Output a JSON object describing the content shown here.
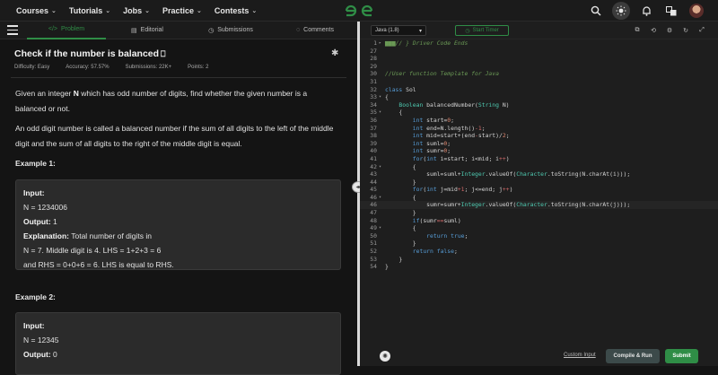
{
  "nav": {
    "items": [
      "Courses",
      "Tutorials",
      "Jobs",
      "Practice",
      "Contests"
    ],
    "icons": [
      "search-icon",
      "theme-toggle-icon",
      "bell-icon",
      "translate-icon"
    ]
  },
  "tabs": [
    {
      "icon": "</>",
      "label": "Problem"
    },
    {
      "icon": "▤",
      "label": "Editorial"
    },
    {
      "icon": "◷",
      "label": "Submissions"
    },
    {
      "icon": "◌",
      "label": "Comments"
    }
  ],
  "problem": {
    "title": "Check if the number is balanced",
    "difficulty": "Difficulty: Easy",
    "accuracy": "Accuracy: 57.57%",
    "submissions": "Submissions: 22K+",
    "points": "Points: 2",
    "para1_pre": "Given an integer ",
    "para1_bold": "N",
    "para1_post": " which has odd number of digits, find whether the given number is a balanced or not.",
    "para2": "An odd digit number is called a balanced number if the sum of all digits to the left of the middle digit and the sum of all digits to the right of the middle digit is equal.",
    "example1": {
      "heading": "Example 1:",
      "input_label": "Input:",
      "input_value": "N = 1234006",
      "output_label": "Output:",
      "output_value": " 1",
      "explanation_label": "Explanation:",
      "explanation_lines": [
        " Total  number  of  digits  in",
        "N = 7. Middle digit is 4. LHS = 1+2+3 = 6",
        "and  RHS = 0+0+6 = 6. LHS is equal to RHS."
      ]
    },
    "example2": {
      "heading": "Example 2:",
      "input_label": "Input:",
      "input_value": "N = 12345",
      "output_label": "Output:",
      "output_value": " 0"
    }
  },
  "editor": {
    "language": "Java (1.8)",
    "timer_label": "Start Timer",
    "tool_icons": [
      "copy-icon",
      "reset-icon",
      "settings-icon",
      "refresh-icon",
      "fullscreen-icon"
    ],
    "lines": [
      {
        "n": "1",
        "f": "▸",
        "html": "<span class=\"cmt\">▆▆▆// } Driver Code Ends</span>"
      },
      {
        "n": "27",
        "f": "",
        "html": ""
      },
      {
        "n": "28",
        "f": "",
        "html": ""
      },
      {
        "n": "29",
        "f": "",
        "html": ""
      },
      {
        "n": "30",
        "f": "",
        "html": "<span class=\"cmt\">//User function Template for Java</span>"
      },
      {
        "n": "31",
        "f": "",
        "html": ""
      },
      {
        "n": "32",
        "f": "",
        "html": "<span class=\"kw\">class</span> Sol"
      },
      {
        "n": "33",
        "f": "▾",
        "html": "{"
      },
      {
        "n": "34",
        "f": "",
        "html": "    <span class=\"ty\">Boolean</span> balancedNumber(<span class=\"ty\">String</span> N)"
      },
      {
        "n": "35",
        "f": "▾",
        "html": "    {"
      },
      {
        "n": "36",
        "f": "",
        "html": "        <span class=\"kw\">int</span> start=<span class=\"nm\">0</span>;"
      },
      {
        "n": "37",
        "f": "",
        "html": "        <span class=\"kw\">int</span> end=N.length()<span class=\"op\">-1</span>;"
      },
      {
        "n": "38",
        "f": "",
        "html": "        <span class=\"kw\">int</span> mid=start+(end<span class=\"op\">-</span>start)/<span class=\"nm\">2</span>;"
      },
      {
        "n": "39",
        "f": "",
        "html": "        <span class=\"kw\">int</span> suml=<span class=\"nm\">0</span>;"
      },
      {
        "n": "40",
        "f": "",
        "html": "        <span class=\"kw\">int</span> sumr=<span class=\"nm\">0</span>;"
      },
      {
        "n": "41",
        "f": "",
        "html": "        <span class=\"kw\">for</span>(<span class=\"kw\">int</span> i=start; i&lt;mid; i<span class=\"op\">++</span>)"
      },
      {
        "n": "42",
        "f": "▾",
        "html": "        {"
      },
      {
        "n": "43",
        "f": "",
        "html": "            suml=suml+<span class=\"ty\">Integer</span>.valueOf(<span class=\"ty\">Character</span>.toString(N.charAt(i)));"
      },
      {
        "n": "44",
        "f": "",
        "html": "        }"
      },
      {
        "n": "45",
        "f": "",
        "html": "        <span class=\"kw\">for</span>(<span class=\"kw\">int</span> j=mid<span class=\"op\">+1</span>; j&lt;=end; j<span class=\"op\">++</span>)"
      },
      {
        "n": "46",
        "f": "▾",
        "html": "        {"
      },
      {
        "n": "46",
        "f": "",
        "html": "            sumr=sumr+<span class=\"ty\">Integer</span>.valueOf(<span class=\"ty\">Character</span>.toString(N.charAt(j)));"
      },
      {
        "n": "47",
        "f": "",
        "html": "        }"
      },
      {
        "n": "48",
        "f": "",
        "html": "        <span class=\"kw\">if</span>(sumr<span class=\"op\">==</span>suml)"
      },
      {
        "n": "49",
        "f": "▾",
        "html": "        {"
      },
      {
        "n": "50",
        "f": "",
        "html": "            <span class=\"kw\">return</span> <span class=\"kw\">true</span>;"
      },
      {
        "n": "51",
        "f": "",
        "html": "        }"
      },
      {
        "n": "52",
        "f": "",
        "html": "        <span class=\"kw\">return</span> <span class=\"kw\">false</span>;"
      },
      {
        "n": "53",
        "f": "",
        "html": "    }"
      },
      {
        "n": "54",
        "f": "",
        "html": "}"
      }
    ]
  },
  "footer": {
    "custom_input": "Custom Input",
    "compile_run": "Compile & Run",
    "submit": "Submit"
  }
}
